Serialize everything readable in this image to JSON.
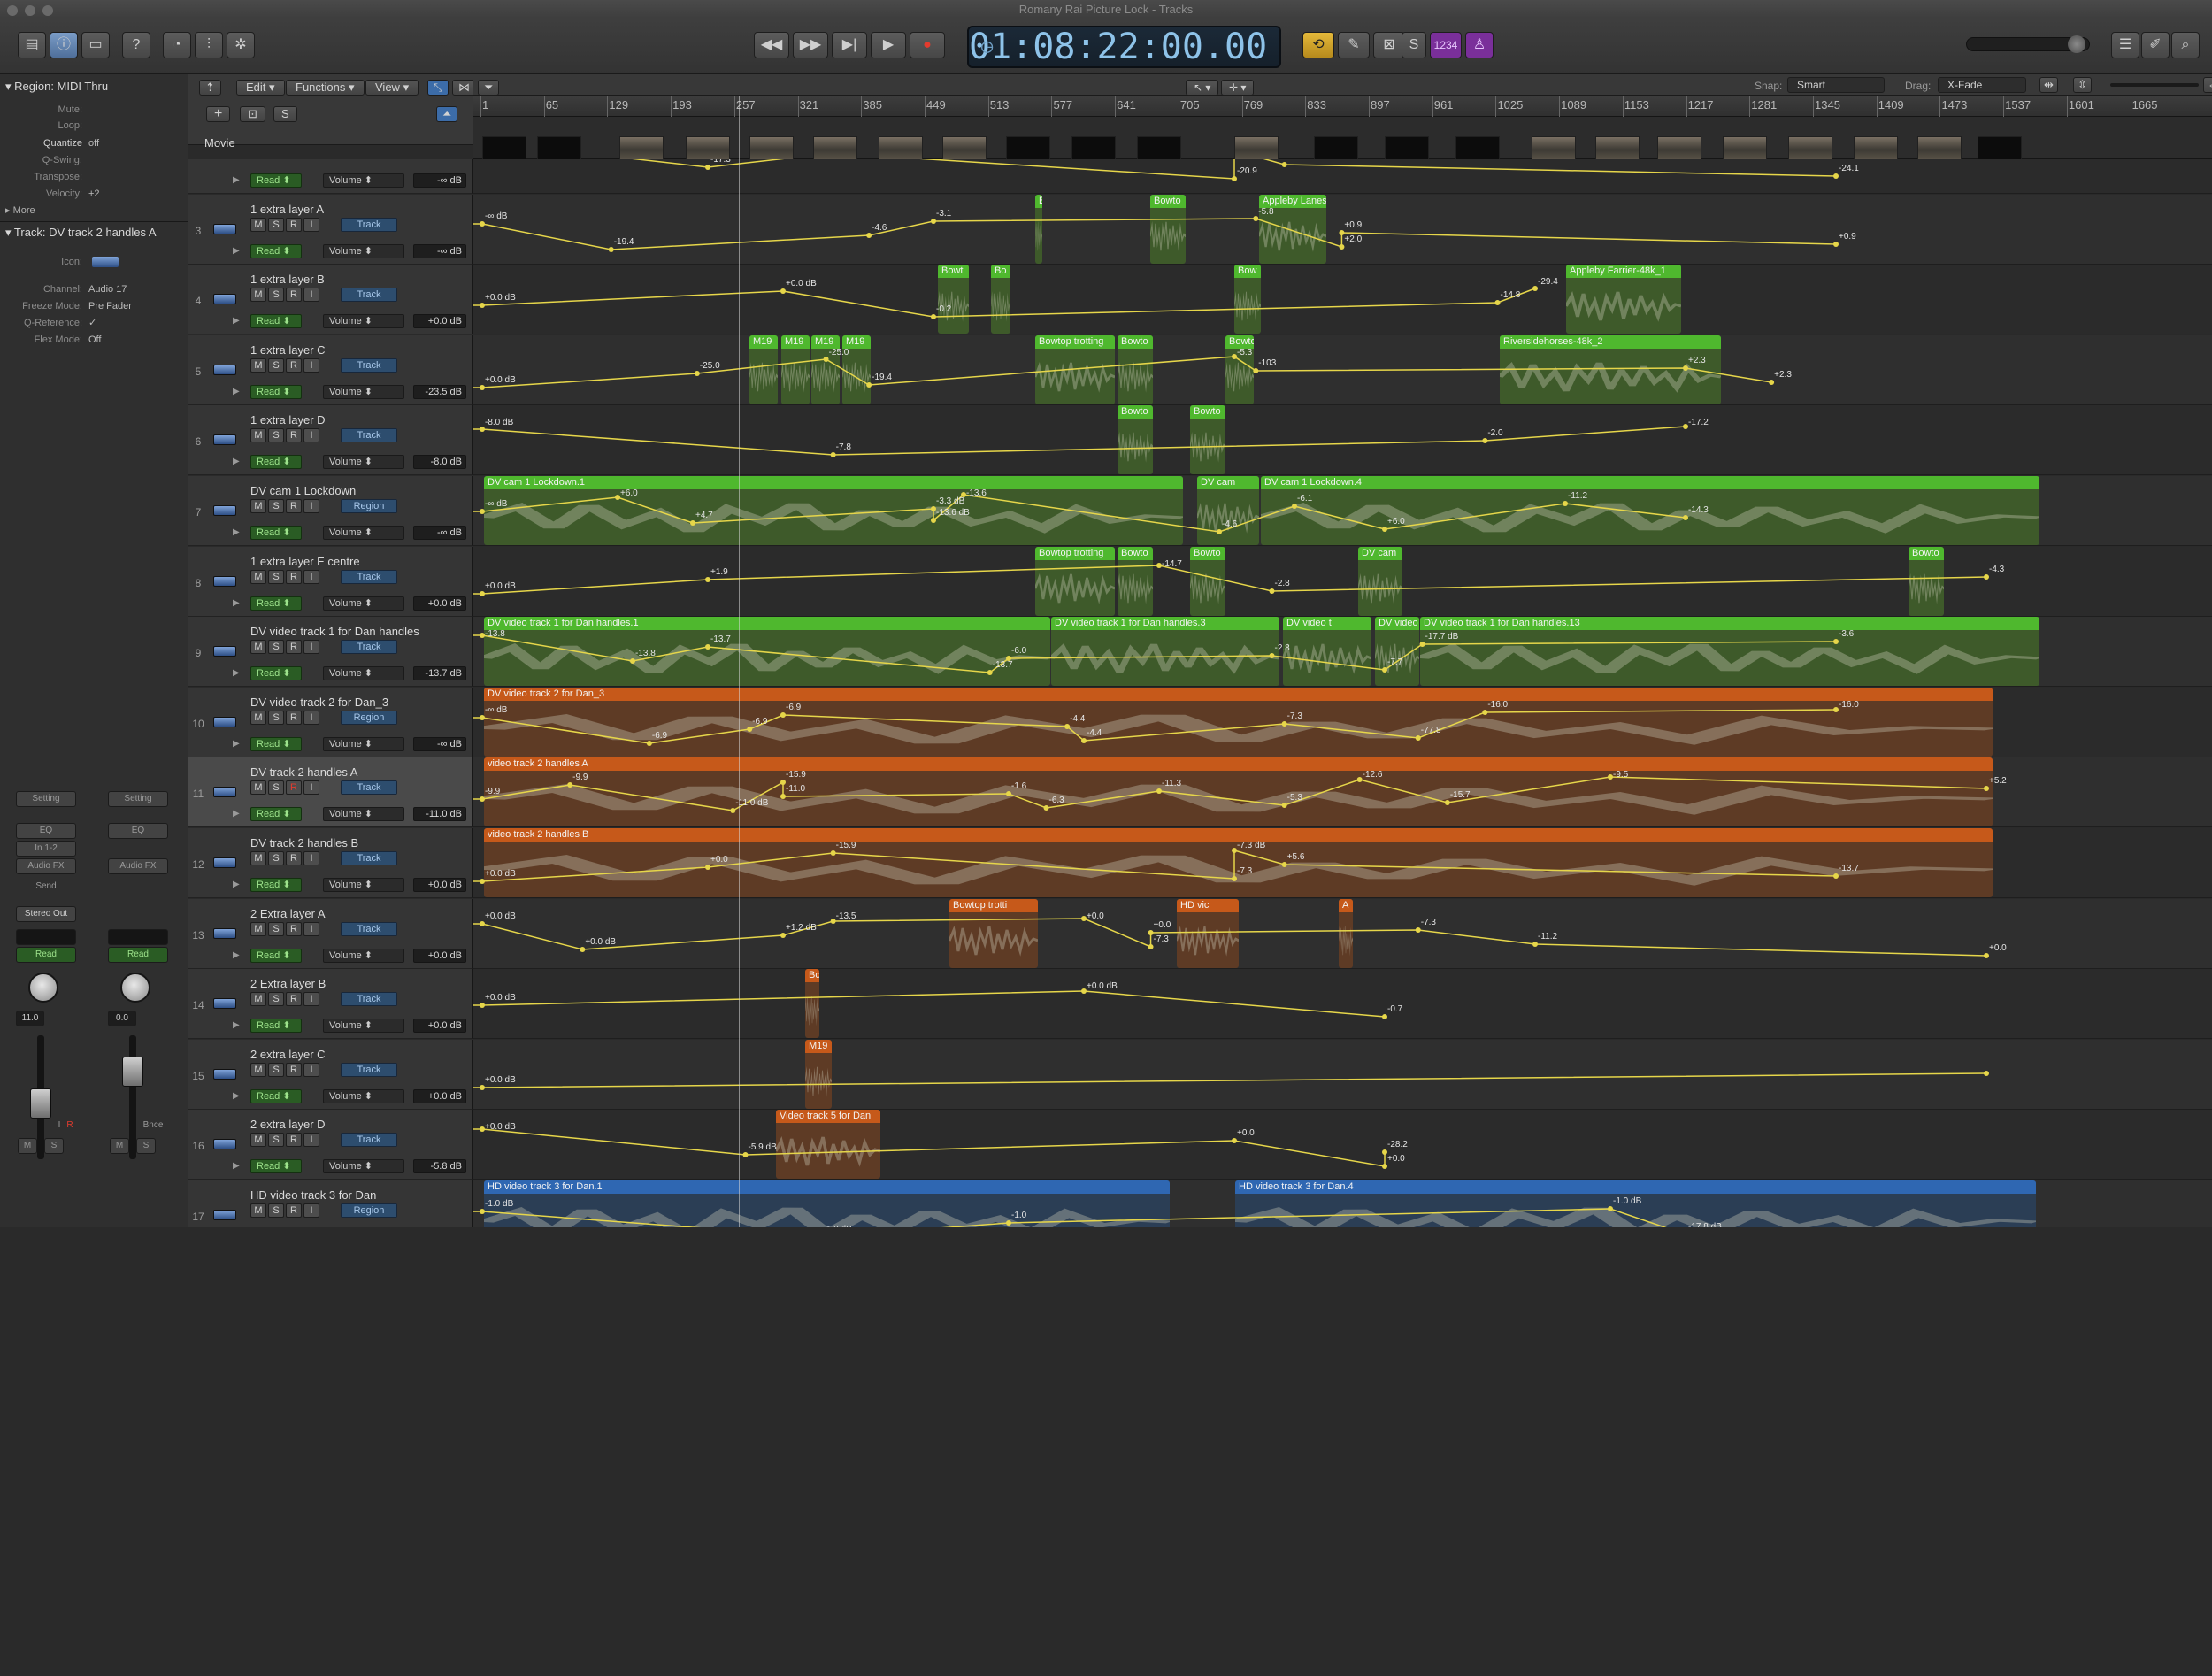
{
  "window": {
    "title": "Romany Rai Picture Lock - Tracks"
  },
  "transport": {
    "timecode": "01:08:22:00.00",
    "cycle_badge": "1234",
    "buttons": [
      "rewind",
      "fast-forward",
      "to-start",
      "play",
      "record"
    ]
  },
  "menubar": {
    "edit": "Edit",
    "functions": "Functions",
    "view": "View"
  },
  "snap": {
    "snap_label": "Snap:",
    "snap_value": "Smart",
    "drag_label": "Drag:",
    "drag_value": "X-Fade"
  },
  "inspector": {
    "region_header": "Region: MIDI Thru",
    "region_rows": [
      {
        "k": "Mute:",
        "v": ""
      },
      {
        "k": "Loop:",
        "v": ""
      },
      {
        "k": "Quantize",
        "v": "off"
      },
      {
        "k": "Q-Swing:",
        "v": ""
      },
      {
        "k": "Transpose:",
        "v": ""
      },
      {
        "k": "Velocity:",
        "v": "+2"
      }
    ],
    "more": "More",
    "track_header": "Track:  DV track 2 handles A",
    "track_rows": [
      {
        "k": "Icon:",
        "v": ""
      },
      {
        "k": "Channel:",
        "v": "Audio 17"
      },
      {
        "k": "Freeze Mode:",
        "v": "Pre Fader"
      },
      {
        "k": "Q-Reference:",
        "v": "✓"
      },
      {
        "k": "Flex Mode:",
        "v": "Off"
      }
    ],
    "strip_left": {
      "setting": "Setting",
      "eq": "EQ",
      "input": "In 1-2",
      "fx": "Audio FX",
      "send": "Send",
      "output": "Stereo Out",
      "read": "Read",
      "vol": "11.0",
      "m": "M",
      "s": "S",
      "i": "I",
      "r": "R"
    },
    "strip_right": {
      "setting": "Setting",
      "eq": "EQ",
      "fx": "Audio FX",
      "read": "Read",
      "vol": "0.0",
      "m": "M",
      "s": "S",
      "bnce": "Bnce"
    }
  },
  "ruler": {
    "ticks": [
      "1",
      "65",
      "129",
      "193",
      "257",
      "321",
      "385",
      "449",
      "513",
      "577",
      "641",
      "705",
      "769",
      "833",
      "897",
      "961",
      "1025",
      "1089",
      "1153",
      "1217",
      "1281",
      "1345",
      "1409",
      "1473",
      "1537",
      "1601",
      "1665"
    ]
  },
  "movie_track": {
    "label": "Movie"
  },
  "track_header_buttons": {
    "add": "+",
    "s": "S"
  },
  "tracks": [
    {
      "num": "",
      "name": "",
      "mode": "",
      "read": "Read",
      "param": "Volume",
      "value": "-∞ dB"
    },
    {
      "num": "3",
      "name": "1 extra layer A",
      "mode": "Track",
      "read": "Read",
      "param": "Volume",
      "value": "-∞ dB"
    },
    {
      "num": "4",
      "name": "1 extra layer B",
      "mode": "Track",
      "read": "Read",
      "param": "Volume",
      "value": "+0.0 dB"
    },
    {
      "num": "5",
      "name": "1 extra layer C",
      "mode": "Track",
      "read": "Read",
      "param": "Volume",
      "value": "-23.5 dB"
    },
    {
      "num": "6",
      "name": "1 extra layer D",
      "mode": "Track",
      "read": "Read",
      "param": "Volume",
      "value": "-8.0 dB"
    },
    {
      "num": "7",
      "name": "DV cam 1 Lockdown",
      "mode": "Region",
      "read": "Read",
      "param": "Volume",
      "value": "-∞ dB"
    },
    {
      "num": "8",
      "name": "1 extra layer E centre",
      "mode": "Track",
      "read": "Read",
      "param": "Volume",
      "value": "+0.0 dB"
    },
    {
      "num": "9",
      "name": "DV video track 1 for Dan handles",
      "mode": "Track",
      "read": "Read",
      "param": "Volume",
      "value": "-13.7 dB"
    },
    {
      "num": "10",
      "name": "DV video track 2 for Dan_3",
      "mode": "Region",
      "read": "Read",
      "param": "Volume",
      "value": "-∞ dB"
    },
    {
      "num": "11",
      "name": "DV track 2 handles A",
      "mode": "Track",
      "read": "Read",
      "param": "Volume",
      "value": "-11.0 dB"
    },
    {
      "num": "12",
      "name": "DV track  2 handles B",
      "mode": "Track",
      "read": "Read",
      "param": "Volume",
      "value": "+0.0 dB"
    },
    {
      "num": "13",
      "name": "2 Extra layer A",
      "mode": "Track",
      "read": "Read",
      "param": "Volume",
      "value": "+0.0 dB"
    },
    {
      "num": "14",
      "name": "2 Extra layer B",
      "mode": "Track",
      "read": "Read",
      "param": "Volume",
      "value": "+0.0 dB"
    },
    {
      "num": "15",
      "name": "2 extra layer C",
      "mode": "Track",
      "read": "Read",
      "param": "Volume",
      "value": "+0.0 dB"
    },
    {
      "num": "16",
      "name": "2 extra layer D",
      "mode": "Track",
      "read": "Read",
      "param": "Volume",
      "value": "-5.8 dB"
    },
    {
      "num": "17",
      "name": "HD video track 3 for Dan",
      "mode": "Region",
      "read": "Read",
      "param": "Volume",
      "value": ""
    }
  ],
  "regions": {
    "r3": [
      "Bowtop trotting",
      "Bowto",
      "Appleby Lanes 2"
    ],
    "r4": [
      "Bowt",
      "Bo",
      "Bow",
      "Appleby Farrier-48k_1"
    ],
    "r5": [
      "M19",
      "M19",
      "M19",
      "M19",
      "Bowtop trotting",
      "Bowto",
      "Bowto",
      "Riversidehorses-48k_2"
    ],
    "r6": [
      "Bowto",
      "Bowto"
    ],
    "r7": [
      "DV cam 1 Lockdown.1",
      "DV cam",
      "DV cam 1 Lockdown.4"
    ],
    "r8": [
      "Bowtop trotting",
      "Bowto",
      "Bowto",
      "DV cam",
      "Bowto"
    ],
    "r9": [
      "DV video track 1 for Dan handles.1",
      "DV video track 1 for Dan handles.3",
      "DV video t",
      "DV video",
      "DV video track 1 for Dan handles.13"
    ],
    "r10": [
      "DV video track 2 for Dan_3"
    ],
    "r11": [
      "video track 2 handles A"
    ],
    "r12": [
      "video track 2 handles B"
    ],
    "r13": [
      "Bowtop trotti",
      "HD vic",
      "A"
    ],
    "r14": [
      "Bo"
    ],
    "r15": [
      "M19"
    ],
    "r16": [
      "Video track 5 for Dan"
    ],
    "r17": [
      "HD video track 3 for Dan.1",
      "HD video track 3 for Dan.4"
    ]
  },
  "automation_labels": {
    "t0": [
      "-∞ dB",
      "-17.3",
      "-20.7",
      "-20.9",
      "-20.7",
      "-25.6",
      "-24.1"
    ],
    "t3": [
      "-∞ dB",
      "-19.4",
      "-4.6",
      "-3.1",
      "-5.8",
      "+2.0",
      "+0.9",
      "+0.9"
    ],
    "t4": [
      "+0.0 dB",
      "+0.0 dB",
      "-0.2",
      "-14.8",
      "-29.4"
    ],
    "t5": [
      "+0.0 dB",
      "-25.0",
      "-25.0",
      "-19.4",
      "-5.3",
      "-103",
      "+2.3",
      "+2.3"
    ],
    "t6": [
      "-8.0 dB",
      "-7.8",
      "-2.0",
      "-17.2"
    ],
    "t7": [
      "-∞ dB",
      "+6.0",
      "+4.7",
      "-3.3 dB",
      "-13.6 dB",
      "-13.6",
      "-4.6",
      "-6.1",
      "+6.0",
      "-11.2",
      "-14.3"
    ],
    "t8": [
      "+0.0 dB",
      "+1.9",
      "-14.7",
      "-2.8",
      "-4.3"
    ],
    "t9": [
      "-13.8",
      "-13.8",
      "-13.7",
      "-13.7",
      "-6.0",
      "-2.8",
      "-7.7",
      "-17.7 dB",
      "-3.6"
    ],
    "t10": [
      "-∞ dB",
      "-6.9",
      "-6.9",
      "-6.9",
      "-4.4",
      "-4.4",
      "-7.3",
      "-77.8",
      "-16.0",
      "-16.0"
    ],
    "t11": [
      "-9.9",
      "-9.9",
      "-11.0 dB",
      "-15.9",
      "-11.0",
      "-1.6",
      "-6.3",
      "-11.3",
      "-5.3",
      "-12.6",
      "-15.7",
      "-9.5",
      "+5.2"
    ],
    "t12": [
      "+0.0 dB",
      "+0.0",
      "-15.9",
      "-7.3",
      "-7.3 dB",
      "+5.6",
      "-13.7"
    ],
    "t13": [
      "+0.0 dB",
      "+0.0 dB",
      "+1.2 dB",
      "-13.5",
      "+0.0",
      "-7.3",
      "+0.0",
      "-7.3",
      "-11.2",
      "+0.0"
    ],
    "t14": [
      "+0.0 dB",
      "+0.0 dB",
      "-0.7"
    ],
    "t15": [
      "+0.0 dB"
    ],
    "t16": [
      "+0.0 dB",
      "-5.9 dB",
      "+0.0",
      "+0.0",
      "-28.2"
    ],
    "t17": [
      "-1.0 dB",
      "-1.0 dB",
      "-1.0",
      "-1.0 dB",
      "-17.8 dB"
    ]
  },
  "colors": {
    "green": "#4fb82e",
    "orange": "#c6591a",
    "blue": "#2f67b2",
    "automation": "#e6d64a"
  }
}
